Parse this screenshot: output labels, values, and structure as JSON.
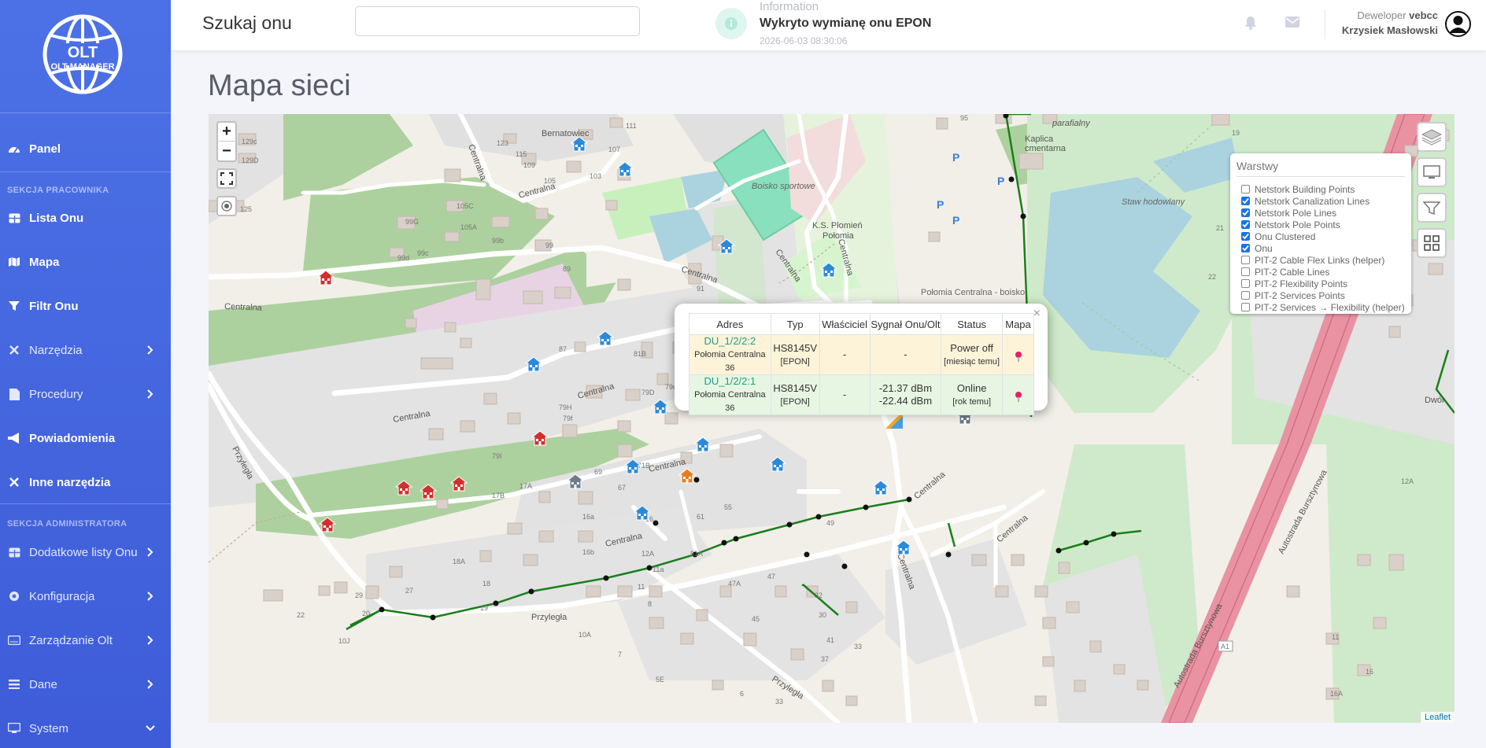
{
  "app": {
    "logo_text": "OLT MANAGER"
  },
  "sidebar": {
    "items": [
      {
        "label": "Panel",
        "icon": "dashboard-icon"
      },
      {
        "label": "Lista Onu",
        "icon": "table-icon"
      },
      {
        "label": "Mapa",
        "icon": "map-icon"
      },
      {
        "label": "Filtr Onu",
        "icon": "filter-icon"
      },
      {
        "label": "Narzędzia",
        "icon": "tools-icon"
      },
      {
        "label": "Procedury",
        "icon": "file-icon"
      },
      {
        "label": "Powiadomienia",
        "icon": "megaphone-icon"
      },
      {
        "label": "Inne narzędzia",
        "icon": "tools-icon"
      },
      {
        "label": "Dodatkowe listy Onu",
        "icon": "table-icon"
      },
      {
        "label": "Konfiguracja",
        "icon": "gear-icon"
      },
      {
        "label": "Zarządzanie Olt",
        "icon": "keyboard-icon"
      },
      {
        "label": "Dane",
        "icon": "list-icon"
      },
      {
        "label": "System",
        "icon": "desktop-icon"
      }
    ],
    "section_worker": "SEKCJA PRACOWNIKA",
    "section_admin": "SEKCJA ADMINISTRATORA"
  },
  "topbar": {
    "search_label": "Szukaj onu",
    "search_value": "",
    "info_title": "Information",
    "info_message": "Wykryto wymianę onu EPON",
    "info_date": "2026-06-03 08:30:06",
    "user_role": "Deweloper",
    "user_login": "vebcc",
    "user_name": "Krzysiek Masłowski"
  },
  "page": {
    "title": "Mapa sieci"
  },
  "map": {
    "zoom_in": "+",
    "zoom_out": "−",
    "attribution": "Leaflet",
    "layers_title": "Warstwy",
    "layers": [
      {
        "label": "Netstork Building Points",
        "checked": false
      },
      {
        "label": "Netstork Canalization Lines",
        "checked": true
      },
      {
        "label": "Netstork Pole Lines",
        "checked": true
      },
      {
        "label": "Netstork Pole Points",
        "checked": true
      },
      {
        "label": "Onu Clustered",
        "checked": true
      },
      {
        "label": "Onu",
        "checked": true
      },
      {
        "label": "PIT-2 Cable Flex Links (helper)",
        "checked": false
      },
      {
        "label": "PIT-2 Cable Lines",
        "checked": false
      },
      {
        "label": "PIT-2 Flexibility Points",
        "checked": false
      },
      {
        "label": "PIT-2 Services Points",
        "checked": false
      },
      {
        "label": "PIT-2 Services → Flexibility (helper)",
        "checked": false
      }
    ],
    "labels": {
      "bernatowiec": "Bernatowiec",
      "centralna": "Centralna",
      "przylegla": "Przyległa",
      "autostrada": "Autostrada Bursztynowa",
      "boisko": "Boisko sportowe",
      "ks": "K.S. Płomień",
      "polomia": "Połomia",
      "polomia_boisko": "Połomia Centralna - boisko",
      "kaplica": "Kaplica",
      "cmentarna": "cmentarna",
      "parafialny": "parafialny",
      "staw": "Staw hodowlany",
      "dwor": "Dwór",
      "a1": "A1"
    }
  },
  "popup": {
    "headers": [
      "Adres",
      "Typ",
      "Właściciel",
      "Sygnał Onu/Olt",
      "Status",
      "Mapa"
    ],
    "rows": [
      {
        "id": "DU_1/2/2:2",
        "addr": "Połomia Centralna 36",
        "type": "HS8145V",
        "type_sub": "[EPON]",
        "owner": "-",
        "signal1": "-",
        "signal2": "",
        "status": "Power off",
        "status_sub": "[miesiąc temu]"
      },
      {
        "id": "DU_1/2/2:1",
        "addr": "Połomia Centralna 36",
        "type": "HS8145V",
        "type_sub": "[EPON]",
        "owner": "-",
        "signal1": "-21.37 dBm",
        "signal2": "-22.44 dBm",
        "status": "Online",
        "status_sub": "[rok temu]"
      }
    ],
    "close": "×"
  }
}
